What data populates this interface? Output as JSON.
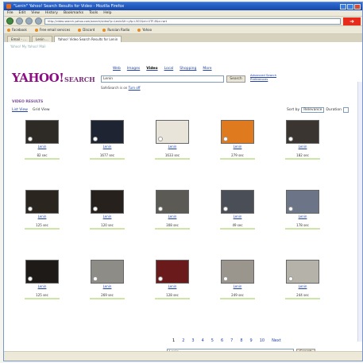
{
  "window": {
    "title": "\"Lenin\" Yahoo! Search Results for Video - Mozilla Firefox",
    "url": "http://video.search.yahoo.com/search/video?p=Lenin&fr=yfp-t-501&ei=UTF-8&x=wrt"
  },
  "menu": [
    "File",
    "Edit",
    "View",
    "History",
    "Bookmarks",
    "Tools",
    "Help"
  ],
  "bookmarks": [
    "Facebook",
    "Free email services",
    "Discord",
    "Russian Radio",
    "Yahoo"
  ],
  "tabs": [
    {
      "label": "Email - ...",
      "active": false
    },
    {
      "label": "Lenin ...",
      "active": false
    },
    {
      "label": "Yahoo! Video Search Results for Lenin",
      "active": true
    }
  ],
  "page": {
    "top_note": "Yahoo! My Yahoo! Mail",
    "logo": "YAHOO!",
    "search_label": "SEARCH",
    "verticals": [
      "Web",
      "Images",
      "Video",
      "Local",
      "Shopping",
      "More"
    ],
    "selected_vertical": "Video",
    "query": "Lenin",
    "search_button": "Search",
    "advanced_links": [
      "Advanced Search",
      "Preferences"
    ],
    "safesearch_text": "SafeSearch is on",
    "safesearch_link": "Turn off",
    "results_title": "VIDEO RESULTS",
    "view_list": "List View",
    "view_grid": "Grid View",
    "sort_label": "Sort by",
    "sort_value": "Relevance",
    "duration_label": "Duration",
    "pager": [
      "1",
      "2",
      "3",
      "4",
      "5",
      "6",
      "7",
      "8",
      "9",
      "10",
      "Next"
    ],
    "bottom_query": "Lenin",
    "bottom_button": "Search"
  },
  "thumbnails": [
    {
      "title": "Lenin",
      "duration": "82 sec",
      "color": "#2e2a26"
    },
    {
      "title": "Lenin",
      "duration": "1677 sec",
      "color": "#1f2433"
    },
    {
      "title": "Lenin",
      "duration": "1633 sec",
      "color": "#e9e4da"
    },
    {
      "title": "Lenin",
      "duration": "279 sec",
      "color": "#e07a1e"
    },
    {
      "title": "Lenin",
      "duration": "182 sec",
      "color": "#3a3530"
    },
    {
      "title": "Lenin",
      "duration": "125 sec",
      "color": "#2b2520"
    },
    {
      "title": "Lenin",
      "duration": "120 sec",
      "color": "#26211c"
    },
    {
      "title": "Lenin",
      "duration": "308 sec",
      "color": "#5c5a55"
    },
    {
      "title": "Lenin",
      "duration": "49 sec",
      "color": "#4a4f57"
    },
    {
      "title": "Lenin",
      "duration": "178 sec",
      "color": "#6c7488"
    },
    {
      "title": "Lenin",
      "duration": "125 sec",
      "color": "#1d1a17"
    },
    {
      "title": "Lenin",
      "duration": "269 sec",
      "color": "#8e8c87"
    },
    {
      "title": "Lenin",
      "duration": "128 sec",
      "color": "#6a1a1a"
    },
    {
      "title": "Lenin",
      "duration": "249 sec",
      "color": "#9a968e"
    },
    {
      "title": "Lenin",
      "duration": "244 sec",
      "color": "#b5b2aa"
    }
  ]
}
